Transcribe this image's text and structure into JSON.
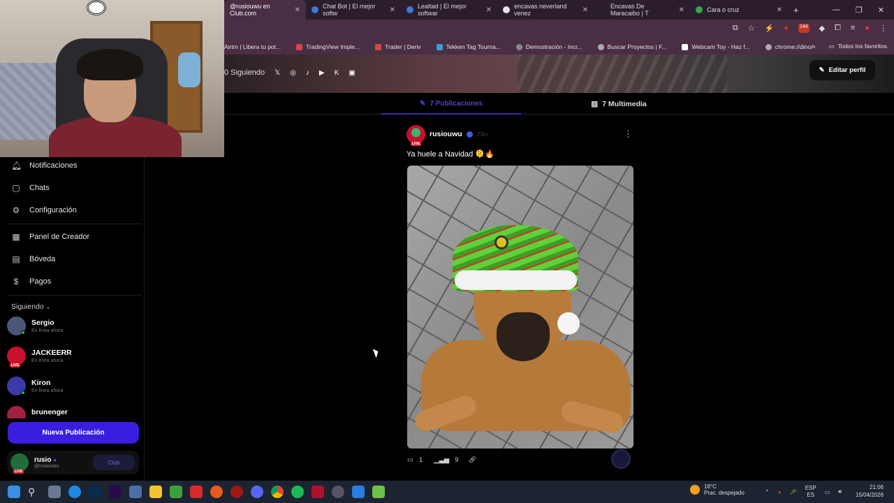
{
  "browser": {
    "tabs": [
      {
        "label": "@rusiouwu en Club.com",
        "active": true
      },
      {
        "label": "Chat Bot | El mejor softw",
        "active": false
      },
      {
        "label": "Lealtad | El mejor softwar",
        "active": false
      },
      {
        "label": "encavas neverland venez",
        "active": false
      },
      {
        "label": "Encavas De Maracaibo | T",
        "active": false
      },
      {
        "label": "Cara o cruz",
        "active": false
      }
    ],
    "toolbar_badge": "144",
    "bookmarks": [
      "Airtm | Libera tu pot...",
      "TradingView Imple...",
      "Trader | Deriv",
      "Tekken Tag Tourna...",
      "Demostración - Incr...",
      "Buscar Proyectos | F...",
      "Webcam Toy - Haz f...",
      "chrome://dino/"
    ],
    "all_bookmarks": "Todos los favoritos"
  },
  "profile": {
    "following_label": "0 Siguiendo",
    "edit_profile": "Editar perfil"
  },
  "feed_tabs": {
    "posts": "7 Publicaciones",
    "media": "7 Multimedia"
  },
  "sidebar": {
    "nav": [
      {
        "label": "Notificaciones",
        "icon": "bell-icon"
      },
      {
        "label": "Chats",
        "icon": "chat-icon"
      },
      {
        "label": "Configuración",
        "icon": "gear-icon"
      },
      {
        "label": "Panel de Creador",
        "icon": "dashboard-icon"
      },
      {
        "label": "Bóveda",
        "icon": "vault-icon"
      },
      {
        "label": "Pagos",
        "icon": "dollar-icon"
      }
    ],
    "following_title": "Siguiendo",
    "following": [
      {
        "name": "Sergio",
        "status": "En línea ahora",
        "live": false
      },
      {
        "name": "JACKEERR",
        "status": "En línea ahora",
        "live": true
      },
      {
        "name": "Kiron",
        "status": "En línea ahora",
        "live": false
      },
      {
        "name": "brunenger",
        "status": "",
        "live": false
      }
    ],
    "new_post": "Nueva Publicación",
    "me": {
      "name": "rusio",
      "handle": "@rusiouwu",
      "coin": "Club"
    }
  },
  "post": {
    "user": "rusiouwu",
    "time": "23m",
    "live_badge": "LIVE",
    "text": "Ya huele a Navidad 🫠🔥",
    "comments": "1",
    "views": "9"
  },
  "taskbar": {
    "weather_temp": "18°C",
    "weather_desc": "Prac. despejado",
    "lang": "ESP",
    "lang_sub": "ES",
    "time": "21:06",
    "date": "15/04/2026"
  },
  "colors": {
    "accent": "#3a1ee0",
    "tab_active": "#5b3bd6",
    "chrome": "#4a2e43"
  }
}
